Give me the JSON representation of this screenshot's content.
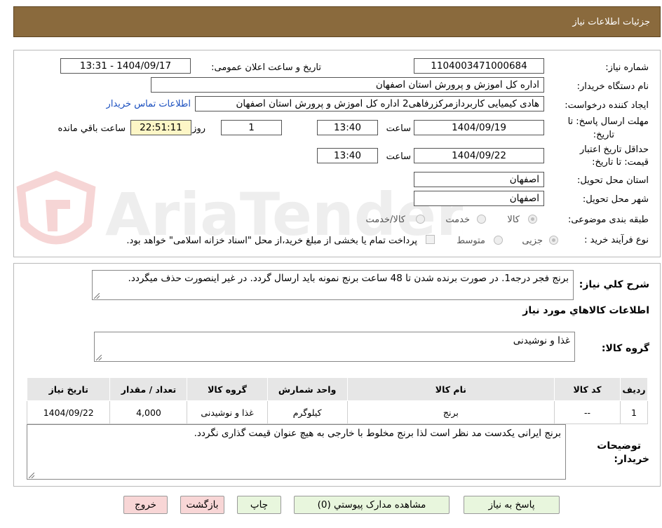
{
  "header": {
    "title": "جزئیات اطلاعات نیاز"
  },
  "fields": {
    "need_number_label": "شماره نیاز:",
    "need_number": "1104003471000684",
    "announce_label": "تاریخ و ساعت اعلان عمومی:",
    "announce_value": "1404/09/17 - 13:31",
    "buyer_org_label": "نام دستگاه خریدار:",
    "buyer_org": "اداره کل اموزش و پرورش استان اصفهان",
    "requester_label": "ایجاد کننده درخواست:",
    "requester": "هادی کیمیایی کاربردازمرکزرفاهی2 اداره کل اموزش و پرورش استان اصفهان",
    "contact_link": "اطلاعات تماس خریدار",
    "deadline_label_1": "مهلت ارسال پاسخ: تا",
    "deadline_label_2": "تاریخ:",
    "deadline_date": "1404/09/19",
    "time_label": "ساعت",
    "deadline_time": "13:40",
    "days_value": "1",
    "days_label": "روز و",
    "remaining_time": "22:51:11",
    "remaining_label": "ساعت باقي مانده",
    "validity_label_1": "حداقل تاریخ اعتبار",
    "validity_label_2": "قیمت: تا تاریخ:",
    "validity_date": "1404/09/22",
    "validity_time": "13:40",
    "province_label": "استان محل تحویل:",
    "province": "اصفهان",
    "city_label": "شهر محل تحویل:",
    "city": "اصفهان",
    "category_label": "طبقه بندی موضوعی:",
    "category_options": [
      "کالا",
      "خدمت",
      "کالا/خدمت"
    ],
    "process_label": "نوع فرآیند خرید :",
    "process_options": [
      "جزیی",
      "متوسط"
    ],
    "payment_note": "پرداخت تمام یا بخشی از مبلغ خرید،از محل \"اسناد خزانه اسلامی\" خواهد بود."
  },
  "summary": {
    "label": "شرح کلي نياز:",
    "text": "برنج فجر درجه1. در صورت برنده شدن تا 48 ساعت برنج نمونه باید ارسال گردد. در غیر اینصورت حذف میگردد."
  },
  "goods": {
    "section_title": "اطلاعات كالاهاي مورد نياز",
    "group_label": "گروه کالا:",
    "group_value": "غذا و نوشیدنی",
    "table": {
      "headers": [
        "ردیف",
        "کد کالا",
        "نام کالا",
        "واحد شمارش",
        "گروه کالا",
        "تعداد / مقدار",
        "تاریخ نیاز"
      ],
      "rows": [
        [
          "1",
          "--",
          "برنج",
          "کیلوگرم",
          "غذا و نوشیدنی",
          "4,000",
          "1404/09/22"
        ]
      ]
    },
    "buyer_notes_label_1": "توضیحات",
    "buyer_notes_label_2": "خریدار:",
    "buyer_notes": "برنج ایرانی یکدست مد نظر است لذا برنج مخلوط با خارجی به هیچ عنوان قیمت گذاری نگردد."
  },
  "buttons": {
    "reply": "پاسخ به نیاز",
    "attachments": "مشاهده مدارک پیوستي (0)",
    "print": "چاپ",
    "back": "بازگشت",
    "exit": "خروج"
  },
  "watermark": {
    "text": "AriaTender.neT"
  },
  "colors": {
    "header_bg": "#8a6a3d",
    "link": "#1a4fbf",
    "yellow_box": "#fdf6c6",
    "green_btn": "#e8f6dd",
    "pink_btn": "#f8d6d6"
  }
}
